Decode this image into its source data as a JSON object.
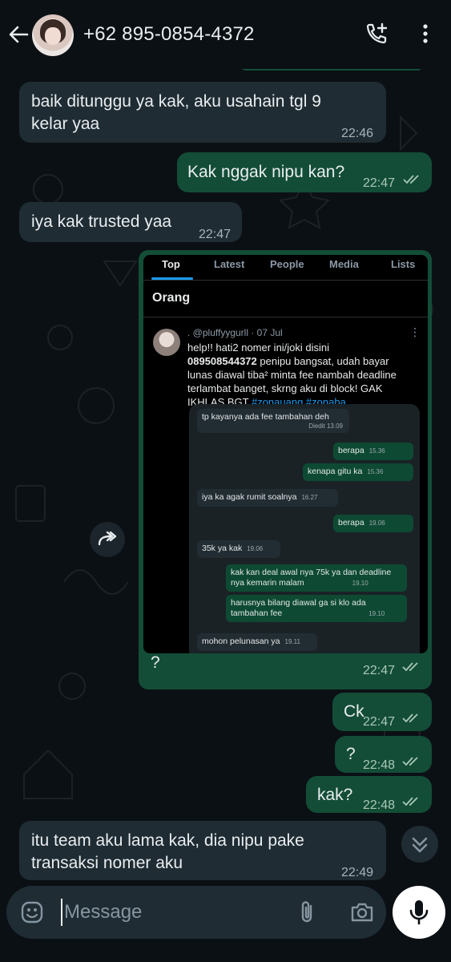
{
  "header": {
    "title": "+62 895-0854-4372"
  },
  "messages": [
    {
      "dir": "in",
      "text_line1": "baik ditunggu ya kak, aku usahain tgl 9",
      "text_line2": "kelar yaa",
      "time": "22:46"
    },
    {
      "dir": "out",
      "text": "Kak nggak nipu kan?",
      "time": "22:47"
    },
    {
      "dir": "in",
      "text": "iya kak trusted yaa",
      "time": "22:47"
    },
    {
      "dir": "out",
      "caption": "?",
      "time": "22:47"
    },
    {
      "dir": "out",
      "text": "Ck",
      "time": "22:47"
    },
    {
      "dir": "out",
      "text": "?",
      "time": "22:48"
    },
    {
      "dir": "out",
      "text": "kak?",
      "time": "22:48"
    },
    {
      "dir": "in",
      "text_line1": "itu team aku lama kak, dia nipu pake",
      "text_line2": "transaksi nomer aku",
      "time": "22:49"
    }
  ],
  "embedded_screenshot": {
    "tabs": [
      "Top",
      "Latest",
      "People",
      "Media",
      "Lists"
    ],
    "section": "Orang",
    "handle": ". @pluffyygurll · 07 Jul",
    "tweet_line1": "help!! hati2 nomer ini/joki disini",
    "tweet_number": "089508544372",
    "tweet_line2_rest": " penipu bangsat, udah bayar",
    "tweet_line3": "lunas diawal tiba² minta fee nambah deadline",
    "tweet_line4": "terlambat banget, skrng aku di block! GAK",
    "tweet_line5_pre": "IKHLAS BGT ",
    "tweet_tags": "#zonauang #zonaba",
    "inner_chat": [
      {
        "dir": "in",
        "text": "tp kayanya ada fee tambahan deh",
        "time": "Diedit 13.09"
      },
      {
        "dir": "out",
        "text": "berapa",
        "time": "15.36"
      },
      {
        "dir": "out",
        "text": "kenapa gitu ka",
        "time": "15.36"
      },
      {
        "dir": "in",
        "text": "iya ka agak rumit soalnya",
        "time": "16.27"
      },
      {
        "dir": "out",
        "text": "berapa",
        "time": "19.06"
      },
      {
        "dir": "in",
        "text": "35k ya kak",
        "time": "19.06"
      },
      {
        "dir": "out",
        "text": "kak kan deal awal nya 75k ya dan deadline",
        "text2": "nya kemarin malam",
        "time": "19.10"
      },
      {
        "dir": "out",
        "text": "harusnya bilang diawal ga si klo ada",
        "text2": "tambahan fee",
        "time": "19.10"
      },
      {
        "dir": "in",
        "text": "mohon pelunasan ya",
        "time": "19.11"
      }
    ]
  },
  "composer": {
    "placeholder": "Message"
  },
  "icons": [
    "back-arrow-icon",
    "avatar",
    "add-call-icon",
    "more-vert-icon",
    "forward-icon",
    "scroll-down-icon",
    "emoji-icon",
    "attach-icon",
    "camera-icon",
    "mic-icon"
  ],
  "colors": {
    "background": "#0b1014",
    "incoming": "#1f2c34",
    "outgoing": "#134d37",
    "accent": "#1d9bf0"
  }
}
